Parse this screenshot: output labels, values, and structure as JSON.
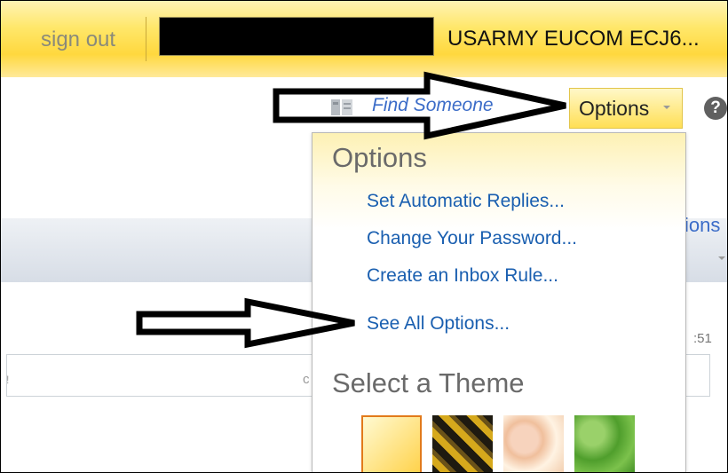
{
  "topbar": {
    "sign_out": "sign out",
    "user_name": "USARMY EUCOM ECJ6..."
  },
  "header": {
    "find_someone": "Find Someone",
    "options_label": "Options",
    "help_symbol": "?"
  },
  "background": {
    "partial_tab": "ions",
    "partial_time": ":51",
    "partial_search_char": "c",
    "partial_left_char": "!"
  },
  "options_menu": {
    "title": "Options",
    "items": [
      "Set Automatic Replies...",
      "Change Your Password...",
      "Create an Inbox Rule...",
      "See All Options..."
    ],
    "theme_heading": "Select a Theme",
    "themes": [
      "theme-sunny",
      "theme-hazard",
      "theme-peach",
      "theme-green"
    ]
  },
  "colors": {
    "topbar_yellow": "#ffd83e",
    "link_blue": "#1a5fb0",
    "selected_theme_border": "#e27a1a"
  }
}
